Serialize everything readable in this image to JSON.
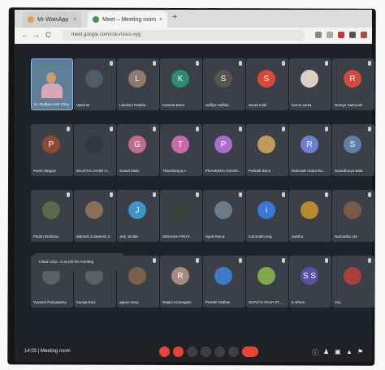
{
  "browser": {
    "tabs": [
      {
        "label": "Mr WatsApp",
        "color": "#d9a441"
      },
      {
        "label": "Meet – Meeting room",
        "color": "#4b8d5a"
      }
    ],
    "url": "meet.google.com/cok-msuo-vyg",
    "new_tab_symbol": "+",
    "nav_back": "←",
    "nav_fwd": "→",
    "nav_reload": "C"
  },
  "participants": [
    {
      "name": "K.I Gulbas-Anis Chou",
      "self": true
    },
    {
      "name": "Vatsh M",
      "initial": "",
      "color": "#4f5d6a"
    },
    {
      "name": "Lakshmi Prabha",
      "initial": "L",
      "color": "#8d7a6a"
    },
    {
      "name": "Kamala Banu",
      "initial": "K",
      "color": "#2b8c72"
    },
    {
      "name": "Saffiya Saffias",
      "initial": "S",
      "color": "#57534e"
    },
    {
      "name": "Sarah Kabi",
      "initial": "S",
      "color": "#d9463b"
    },
    {
      "name": "kannu sarka",
      "initial": "",
      "color": "#d9d1c1"
    },
    {
      "name": "Ramya Sathoosh",
      "initial": "R",
      "color": "#d14a3e"
    },
    {
      "name": "Parvin Begum",
      "initial": "P",
      "color": "#8a4a33"
    },
    {
      "name": "MAJITHA JAHIR H...",
      "initial": "",
      "color": "#2e3a3f"
    },
    {
      "name": "Guwet Malu",
      "initial": "G",
      "color": "#bf6d8a"
    },
    {
      "name": "ThamilSurya A",
      "initial": "T",
      "color": "#c86aa9"
    },
    {
      "name": "PRAVEENA GOVIN...",
      "initial": "P",
      "color": "#a76fc6"
    },
    {
      "name": "Parkath Banu",
      "initial": "",
      "color": "#c29a5b"
    },
    {
      "name": "Rahmath Abdul Ra...",
      "initial": "R",
      "color": "#6f7fcf"
    },
    {
      "name": "Soundharya Bala",
      "initial": "S",
      "color": "#5f7fa9"
    },
    {
      "name": "Parish Reshma",
      "initial": "",
      "color": "#5a6b4a"
    },
    {
      "name": "Mahesh.S Mahesh.S",
      "initial": "",
      "color": "#8a6e58"
    },
    {
      "name": "Jeni Jenitta",
      "initial": "J",
      "color": "#3f93c6"
    },
    {
      "name": "MOHANA PRIYA",
      "initial": "",
      "color": "#3d3f3a"
    },
    {
      "name": "Syed Rinna",
      "initial": "",
      "color": "#6b7b8a"
    },
    {
      "name": "Indumathi eng",
      "initial": "i",
      "color": "#3a77d6"
    },
    {
      "name": "swetha",
      "initial": "",
      "color": "#b88a2e"
    },
    {
      "name": "Narmatha ravi",
      "initial": "",
      "color": "#7a5a45"
    },
    {
      "name": "Yuvaani Pariyasamy",
      "initial": "",
      "color": "#5b5f66"
    },
    {
      "name": "Kaviya Kavi",
      "initial": "",
      "color": "#5b5f66"
    },
    {
      "name": "agnes mary",
      "initial": "",
      "color": "#7a6048"
    },
    {
      "name": "Rajani Arumugam",
      "initial": "R",
      "color": "#a98a80"
    },
    {
      "name": "Preethi Yadhav",
      "initial": "",
      "color": "#3d7ac8"
    },
    {
      "name": "NIVAVYA RAJA ST...",
      "initial": "",
      "color": "#7ea84a"
    },
    {
      "name": "6 others",
      "initial": "S S",
      "color": "#5b4fa3"
    },
    {
      "name": "You",
      "initial": "",
      "color": "#a9413a"
    }
  ],
  "toast": "Infant Unija ..h as left the meeting",
  "bottom_bar": {
    "time": "14:03",
    "meeting": "Meeting room"
  }
}
